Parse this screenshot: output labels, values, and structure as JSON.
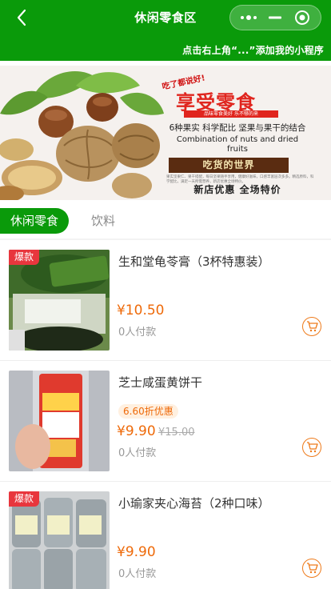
{
  "header": {
    "title": "休闲零食区",
    "hint": "点击右上角“...”添加我的小程序",
    "bg_color": "#0a9a0a"
  },
  "banner": {
    "tag_small": "吃了都说好!",
    "title": "享受零食",
    "subtitle_red": "品味零食美好 乐不够的来",
    "line_cn": "6种果实  科学配比 坚果与果干的结合",
    "line_en1": "Combination of nuts and dried",
    "line_en2": "fruits",
    "box_text": "吃货的世界",
    "fine_print": "果实坚果仁、果干搭配，每日坚果随手享用，健康好滋味，口感丰富层次多多。精选原料，科学配比，满足一天所需营养，新店优惠全场特价。",
    "sale_text": "新店优惠  全场特价"
  },
  "tabs": [
    {
      "label": "休闲零食",
      "active": true
    },
    {
      "label": "饮料",
      "active": false
    }
  ],
  "products": [
    {
      "name": "生和堂龟苓膏（3杯特惠装）",
      "badge": "爆款",
      "discount": "",
      "price": "¥10.50",
      "original_price": "",
      "paid": "0人付款",
      "image_text": "3杯特惠装"
    },
    {
      "name": "芝士咸蛋黄饼干",
      "badge": "",
      "discount": "6.60折优惠",
      "price": "¥9.90",
      "original_price": "¥15.00",
      "paid": "0人付款",
      "image_text": "东友恋"
    },
    {
      "name": "小瑜家夹心海苔（2种口味）",
      "badge": "爆款",
      "discount": "",
      "price": "¥9.90",
      "original_price": "",
      "paid": "0人付款",
      "image_text": ""
    }
  ],
  "colors": {
    "accent": "#0a9a0a",
    "price": "#ee6a0a",
    "badge": "#e8363d"
  }
}
